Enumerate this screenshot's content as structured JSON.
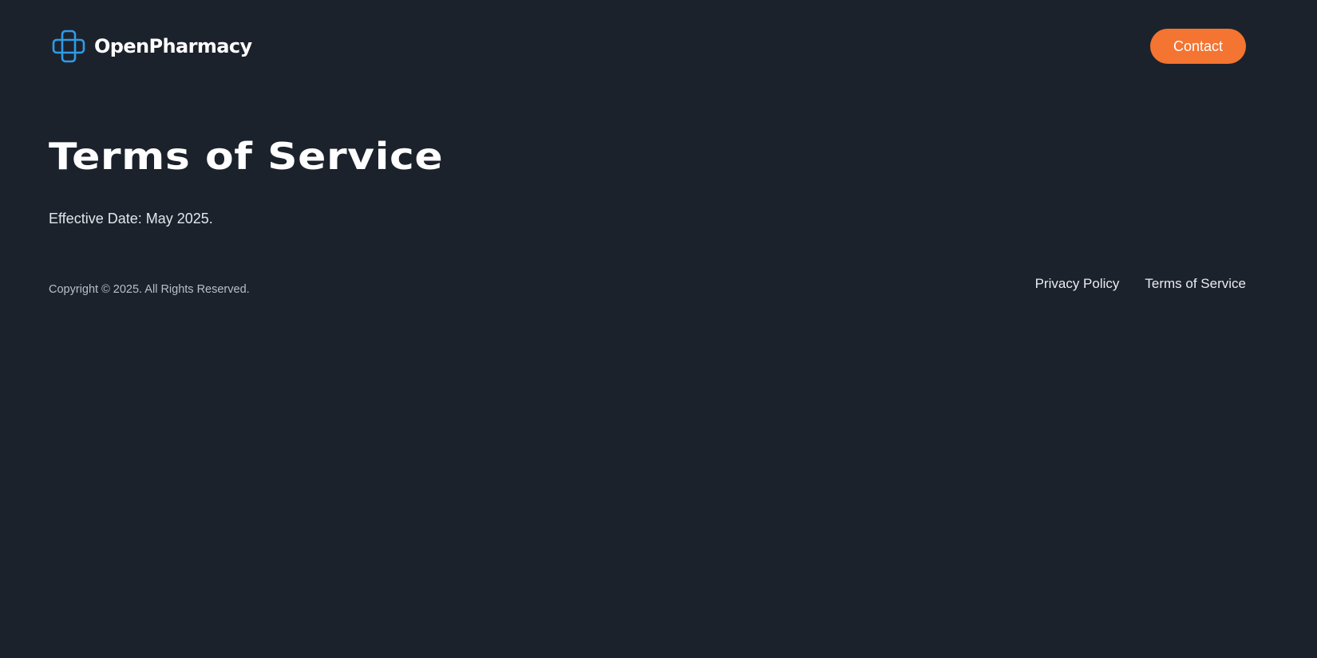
{
  "header": {
    "brand_name": "OpenPharmacy",
    "brand_icon": "medical-cross-icon",
    "contact_label": "Contact"
  },
  "main": {
    "title": "Terms of Service",
    "effective_date": "Effective Date: May 2025."
  },
  "footer": {
    "copyright": "Copyright © 2025. All Rights Reserved.",
    "links": [
      {
        "label": "Privacy Policy"
      },
      {
        "label": "Terms of Service"
      }
    ]
  },
  "colors": {
    "background": "#1c222c",
    "accent": "#f47431",
    "brand_icon": "#2f9be6",
    "text": "#ffffff",
    "muted_text": "#b9bfc8"
  }
}
